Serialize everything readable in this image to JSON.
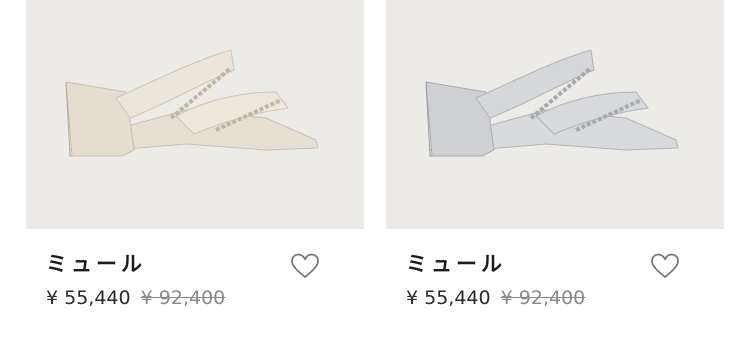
{
  "products": [
    {
      "name": "ミュール",
      "price": "¥ 55,440",
      "original_price": "¥ 92,400",
      "image_icon": "cream-leather-mule",
      "wishlist_icon": "heart-outline-icon"
    },
    {
      "name": "ミュール",
      "price": "¥ 55,440",
      "original_price": "¥ 92,400",
      "image_icon": "silver-metallic-mule",
      "wishlist_icon": "heart-outline-icon"
    }
  ],
  "colors": {
    "image_background": "#ecebe7",
    "cream_shoe": "#e8e1d4",
    "silver_shoe": "#cfd0d3",
    "text": "#1b1b1b",
    "strikethrough": "#8a8a8a"
  }
}
